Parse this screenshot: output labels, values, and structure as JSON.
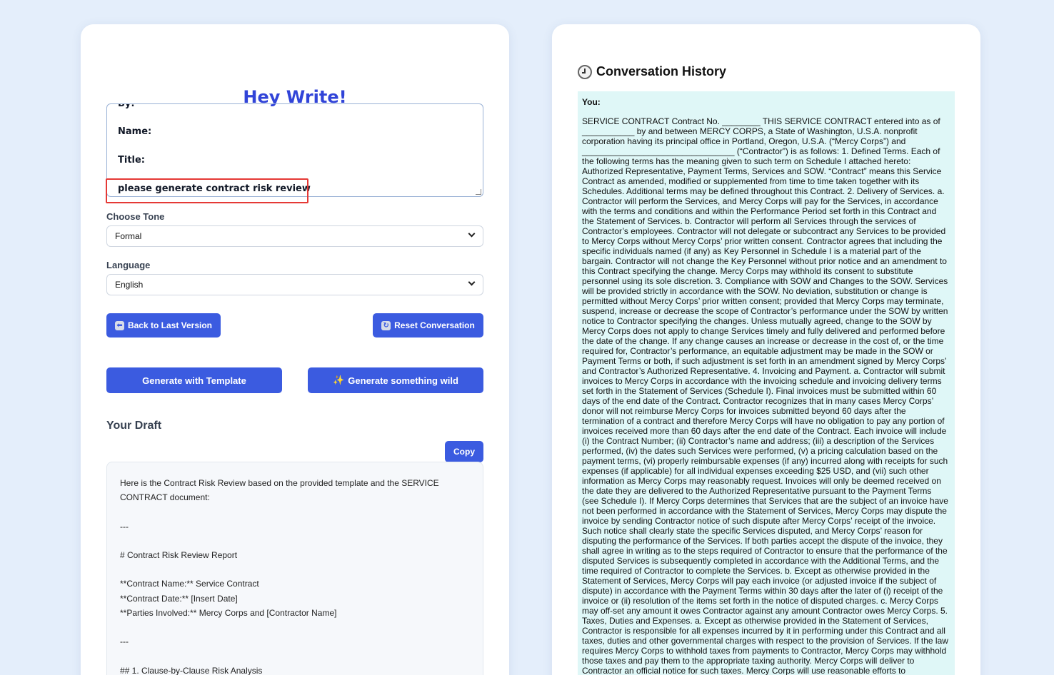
{
  "app": {
    "title": "Hey Write!"
  },
  "prompt": {
    "lines": [
      "By:",
      "Name:",
      "Title:",
      "please generate contract risk review"
    ]
  },
  "tone": {
    "label": "Choose Tone",
    "selected": "Formal"
  },
  "language": {
    "label": "Language",
    "selected": "English"
  },
  "buttons": {
    "back": "Back to Last Version",
    "back_icon": "left-arrow-icon",
    "reset": "Reset Conversation",
    "reset_icon": "refresh-icon",
    "template": "Generate with Template",
    "wild": "Generate something wild",
    "wild_icon": "sparkles-icon",
    "copy": "Copy"
  },
  "draft": {
    "heading": "Your Draft",
    "text": "Here is the Contract Risk Review based on the provided template and the SERVICE CONTRACT document:\n\n---\n\n# Contract Risk Review Report\n\n**Contract Name:** Service Contract\n**Contract Date:** [Insert Date]\n**Parties Involved:** Mercy Corps and [Contractor Name]\n\n---\n\n## 1. Clause-by-Clause Risk Analysis"
  },
  "history": {
    "title": "Conversation History",
    "icon": "clock-icon",
    "sender": "You:",
    "message": "SERVICE CONTRACT Contract No. ________ THIS SERVICE CONTRACT entered into as of ___________ by and between MERCY CORPS, a State of Washington, U.S.A. nonprofit corporation having its principal office in Portland, Oregon, U.S.A. (“Mercy Corps”) and ________________________________ (“Contractor”) is as follows: 1. Defined Terms. Each of the following terms has the meaning given to such term on Schedule I attached hereto: Authorized Representative, Payment Terms, Services and SOW. “Contract” means this Service Contract as amended, modified or supplemented from time to time taken together with its Schedules. Additional terms may be defined throughout this Contract. 2. Delivery of Services. a. Contractor will perform the Services, and Mercy Corps will pay for the Services, in accordance with the terms and conditions and within the Performance Period set forth in this Contract and the Statement of Services. b. Contractor will perform all Services through the services of Contractor’s employees. Contractor will not delegate or subcontract any Services to be provided to Mercy Corps without Mercy Corps’ prior written consent. Contractor agrees that including the specific individuals named (if any) as Key Personnel in Schedule I is a material part of the bargain. Contractor will not change the Key Personnel without prior notice and an amendment to this Contract specifying the change. Mercy Corps may withhold its consent to substitute personnel using its sole discretion. 3. Compliance with SOW and Changes to the SOW. Services will be provided strictly in accordance with the SOW. No deviation, substitution or change is permitted without Mercy Corps’ prior written consent; provided that Mercy Corps may terminate, suspend, increase or decrease the scope of Contractor’s performance under the SOW by written notice to Contractor specifying the changes. Unless mutually agreed, change to the SOW by Mercy Corps does not apply to change Services timely and fully delivered and performed before the date of the change. If any change causes an increase or decrease in the cost of, or the time required for, Contractor’s performance, an equitable adjustment may be made in the SOW or Payment Terms or both, if such adjustment is set forth in an amendment signed by Mercy Corps’ and Contractor’s Authorized Representative. 4. Invoicing and Payment. a. Contractor will submit invoices to Mercy Corps in accordance with the invoicing schedule and invoicing delivery terms set forth in the Statement of Services (Schedule I). Final invoices must be submitted within 60 days of the end date of the Contract. Contractor recognizes that in many cases Mercy Corps’ donor will not reimburse Mercy Corps for invoices submitted beyond 60 days after the termination of a contract and therefore Mercy Corps will have no obligation to pay any portion of invoices received more than 60 days after the end date of the Contract. Each invoice will include (i) the Contract Number; (ii) Contractor’s name and address; (iii) a description of the Services performed, (iv) the dates such Services were performed, (v) a pricing calculation based on the payment terms, (vi) properly reimbursable expenses (if any) incurred along with receipts for such expenses (if applicable) for all individual expenses exceeding $25 USD, and (vii) such other information as Mercy Corps may reasonably request. Invoices will only be deemed received on the date they are delivered to the Authorized Representative pursuant to the Payment Terms (see Schedule I). If Mercy Corps determines that Services that are the subject of an invoice have not been performed in accordance with the Statement of Services, Mercy Corps may dispute the invoice by sending Contractor notice of such dispute after Mercy Corps’ receipt of the invoice. Such notice shall clearly state the specific Services disputed, and Mercy Corps’ reason for disputing the performance of the Services. If both parties accept the dispute of the invoice, they shall agree in writing as to the steps required of Contractor to ensure that the performance of the disputed Services is subsequently completed in accordance with the Additional Terms, and the time required of Contractor to complete the Services. b. Except as otherwise provided in the Statement of Services, Mercy Corps will pay each invoice (or adjusted invoice if the subject of dispute) in accordance with the Payment Terms within 30 days after the later of (i) receipt of the invoice or (ii) resolution of the items set forth in the notice of disputed charges. c. Mercy Corps may off-set any amount it owes Contractor against any amount Contractor owes Mercy Corps. 5. Taxes, Duties and Expenses. a. Except as otherwise provided in the Statement of Services, Contractor is responsible for all expenses incurred by it in performing under this Contract and all taxes, duties and other governmental charges with respect to the provision of Services. If the law requires Mercy Corps to withhold taxes from payments to Contractor, Mercy Corps may withhold those taxes and pay them to the appropriate taxing authority. Mercy Corps will deliver to Contractor an official notice for such taxes. Mercy Corps will use reasonable efforts to"
  }
}
